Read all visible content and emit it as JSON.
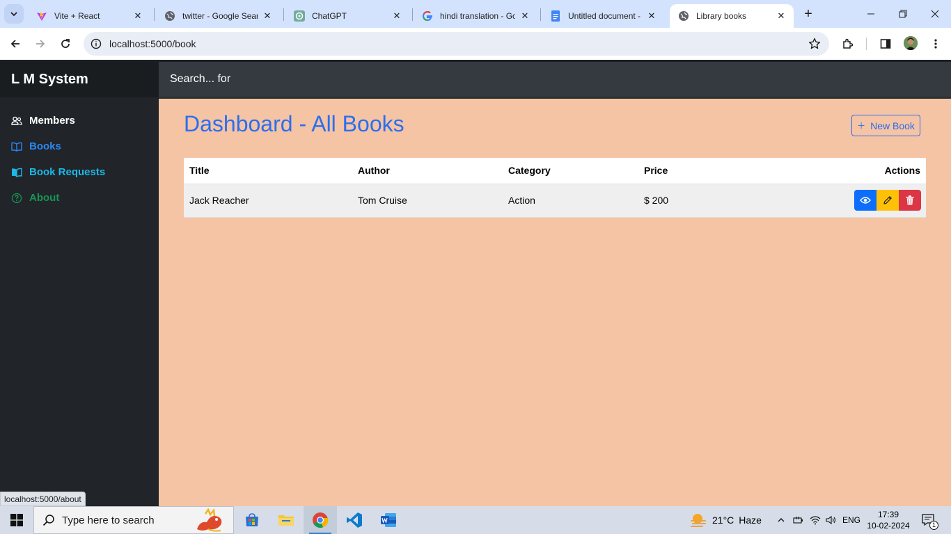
{
  "browser": {
    "tabs": [
      {
        "label": "Vite + React",
        "icon": "vite-icon"
      },
      {
        "label": "twitter - Google Search",
        "icon": "globe-icon"
      },
      {
        "label": "ChatGPT",
        "icon": "chatgpt-icon"
      },
      {
        "label": "hindi translation - Google Search",
        "icon": "google-icon"
      },
      {
        "label": "Untitled document - Google Docs",
        "icon": "docs-icon"
      },
      {
        "label": "Library books",
        "icon": "globe-icon",
        "active": true
      }
    ],
    "url": "localhost:5000/book",
    "status_url": "localhost:5000/about"
  },
  "app": {
    "brand": "L M System",
    "search_placeholder": "Search... for",
    "nav": [
      {
        "label": "Members",
        "icon": "users-icon",
        "color": "#ffffff"
      },
      {
        "label": "Books",
        "icon": "book-open-icon",
        "color": "#2b86f6"
      },
      {
        "label": "Book Requests",
        "icon": "book-icon",
        "color": "#1cb8e8"
      },
      {
        "label": "About",
        "icon": "question-circle-icon",
        "color": "#199454"
      }
    ],
    "page_title": "Dashboard - All Books",
    "new_book_label": "New Book",
    "table": {
      "headers": [
        "Title",
        "Author",
        "Category",
        "Price",
        "Actions"
      ],
      "rows": [
        {
          "title": "Jack Reacher",
          "author": "Tom Cruise",
          "category": "Action",
          "price": "$ 200"
        }
      ]
    },
    "colors": {
      "accent": "#2b6ef0",
      "background": "#f5c4a4",
      "sidebar": "#212529",
      "view": "#0d6efd",
      "edit": "#ffc107",
      "delete": "#dc3545"
    }
  },
  "taskbar": {
    "search_placeholder": "Type here to search",
    "weather": {
      "temp": "21°C",
      "condition": "Haze"
    },
    "language": "ENG",
    "time": "17:39",
    "date": "10-02-2024",
    "notifications": "1"
  }
}
